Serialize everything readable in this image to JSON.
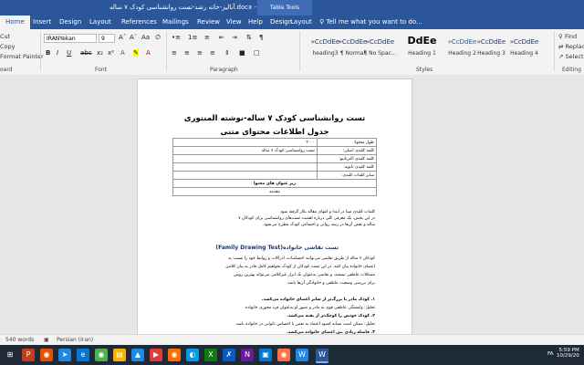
{
  "window": {
    "title": "آنالیز-خانه رشد-تست روانشناسی کودک ۷ ساله.docx - Word",
    "table_tools": "Table Tools"
  },
  "tabs": [
    "Home",
    "Insert",
    "Design",
    "Layout",
    "References",
    "Mailings",
    "Review",
    "View",
    "Help",
    "Design",
    "Layout"
  ],
  "tell_me": "Tell me what you want to do...",
  "ribbon": {
    "clipboard": {
      "cut": "Cut",
      "copy": "Copy",
      "format_painter": "Format Painter",
      "label": "oard"
    },
    "font": {
      "name": "IRANYekan",
      "size": "9",
      "label": "Font",
      "bold": "B",
      "italic": "I",
      "underline": "U"
    },
    "paragraph_label": "Paragraph",
    "styles": [
      {
        "preview": "»CcDdEe",
        "label": "heading3"
      },
      {
        "preview": "»CcDdEe",
        "label": "¶ Normal"
      },
      {
        "preview": "»CcDdEe",
        "label": "¶ No Spac..."
      },
      {
        "preview": "DdEe",
        "label": "Heading 1"
      },
      {
        "preview": "»CcDdEe",
        "label": "Heading 2"
      },
      {
        "preview": "»CcDdEe",
        "label": "Heading 3"
      },
      {
        "preview": "»CcDdEe",
        "label": "Heading 4"
      }
    ],
    "styles_label": "Styles",
    "editing": {
      "find": "Find",
      "replace": "Replace",
      "select": "Select",
      "label": "Editing"
    }
  },
  "document": {
    "title": "تست روانشناسی کودک ۷ ساله-نوشته المنتوری",
    "table_heading": "جدول اطلاعات محتوای متنی",
    "table_rows": [
      {
        "label": "طول محتوا:",
        "value": "۳۰۰۰"
      },
      {
        "label": "کلمه کلیدی اصلی:",
        "value": "تست روانشناسی کودک ۷ ساله"
      },
      {
        "label": "کلمه کلیدی اکنرنانیو:",
        "value": ""
      },
      {
        "label": "کلمه کلیدی ثانویه:",
        "value": ""
      },
      {
        "label": "سایر کلمات کلیدی:",
        "value": ""
      }
    ],
    "subheadings_row": "زیر عنوان های محتوا",
    "intro_label": "مقدمه",
    "intro_lines": [
      "کلمات کلیدی مبنا در ابتدا و انتهای مقاله بکار گرفته شود",
      "در این بخش، یک معرفی کلی درباره اهمیت تست‌های روانشناسی برای کودکان ۷",
      "ساله و نقش آن‌ها در رشد روانی و اجتماعی کودک مطرح می‌شود."
    ],
    "section_title": "تست نقاشی خانواده(Family Drawing Test)",
    "body_lines": [
      "کودکان ۷ ساله از طریق نقاشی می‌توانند احساسات، ادراکات و روابط خود را نسبت به",
      "اعضای خانواده بیان کنند. در این تست کودکان از کودک بخواهیم کامل قادر به بیان کلامی",
      "مشکلات عاطفی نیستند، و نقاشی به‌عنوان یک ابزار غیرکلامی می‌تواند بهترین روش",
      "برای بررسی وضعیت عاطفی و خانوادگی آن‌ها باشد.",
      "",
      "۱.  کودک مادر یا بزرگ‌تر از سایر اعضای خانواده می‌کشد.",
      "تحلیل: وابستگی عاطفی قوی به مادر و تصور او به‌عنوان فرد محوری خانواده.",
      "۲.  کودک خودش را کوچک‌تر از بقیه می‌کشد.",
      "تحلیل: ممکن است نشانه کمبود اعتماد به نفس یا احساس ناتوانی در خانواده باشد.",
      "۳.  فاصله زیادی بین اعضای خانواده می‌کشد."
    ]
  },
  "status": {
    "words": "540 words",
    "language": "Persian (Iran)"
  },
  "taskbar": {
    "lang": "FA",
    "time": "5:59 PM",
    "date": "10/29/20"
  },
  "colors": {
    "accent": "#2b579a",
    "taskbar": "#1f2a38"
  }
}
